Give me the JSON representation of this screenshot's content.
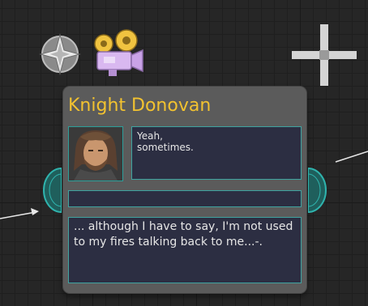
{
  "node": {
    "title": "Knight Donovan",
    "line_text": "Yeah,\nsometimes.",
    "response_text": "... although I have to say, I'm not used to my fires talking back to me...-."
  },
  "icons": {
    "compass": "compass-star-icon",
    "camera": "movie-camera-icon",
    "move": "move-cross-icon"
  },
  "colors": {
    "title": "#f2c230",
    "textbox_bg": "#2c2e42",
    "textbox_border": "#3fa3a0",
    "pin": "#2fb3ad",
    "node_bg": "#5b5b5b"
  }
}
